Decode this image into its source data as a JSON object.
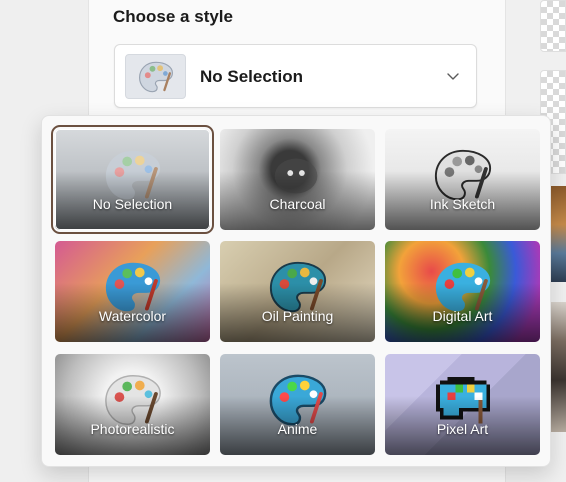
{
  "section": {
    "title": "Choose a style"
  },
  "select": {
    "value": "No Selection",
    "thumb_icon": "palette-icon",
    "chevron_icon": "chevron-down-icon"
  },
  "styles": [
    {
      "label": "No Selection",
      "selected": true
    },
    {
      "label": "Charcoal",
      "selected": false
    },
    {
      "label": "Ink Sketch",
      "selected": false
    },
    {
      "label": "Watercolor",
      "selected": false
    },
    {
      "label": "Oil Painting",
      "selected": false
    },
    {
      "label": "Digital Art",
      "selected": false
    },
    {
      "label": "Photorealistic",
      "selected": false
    },
    {
      "label": "Anime",
      "selected": false
    },
    {
      "label": "Pixel Art",
      "selected": false
    }
  ],
  "colors": {
    "selected_outline": "#6b5040",
    "panel": "#fafafa",
    "flyout": "#f9f9f9"
  }
}
